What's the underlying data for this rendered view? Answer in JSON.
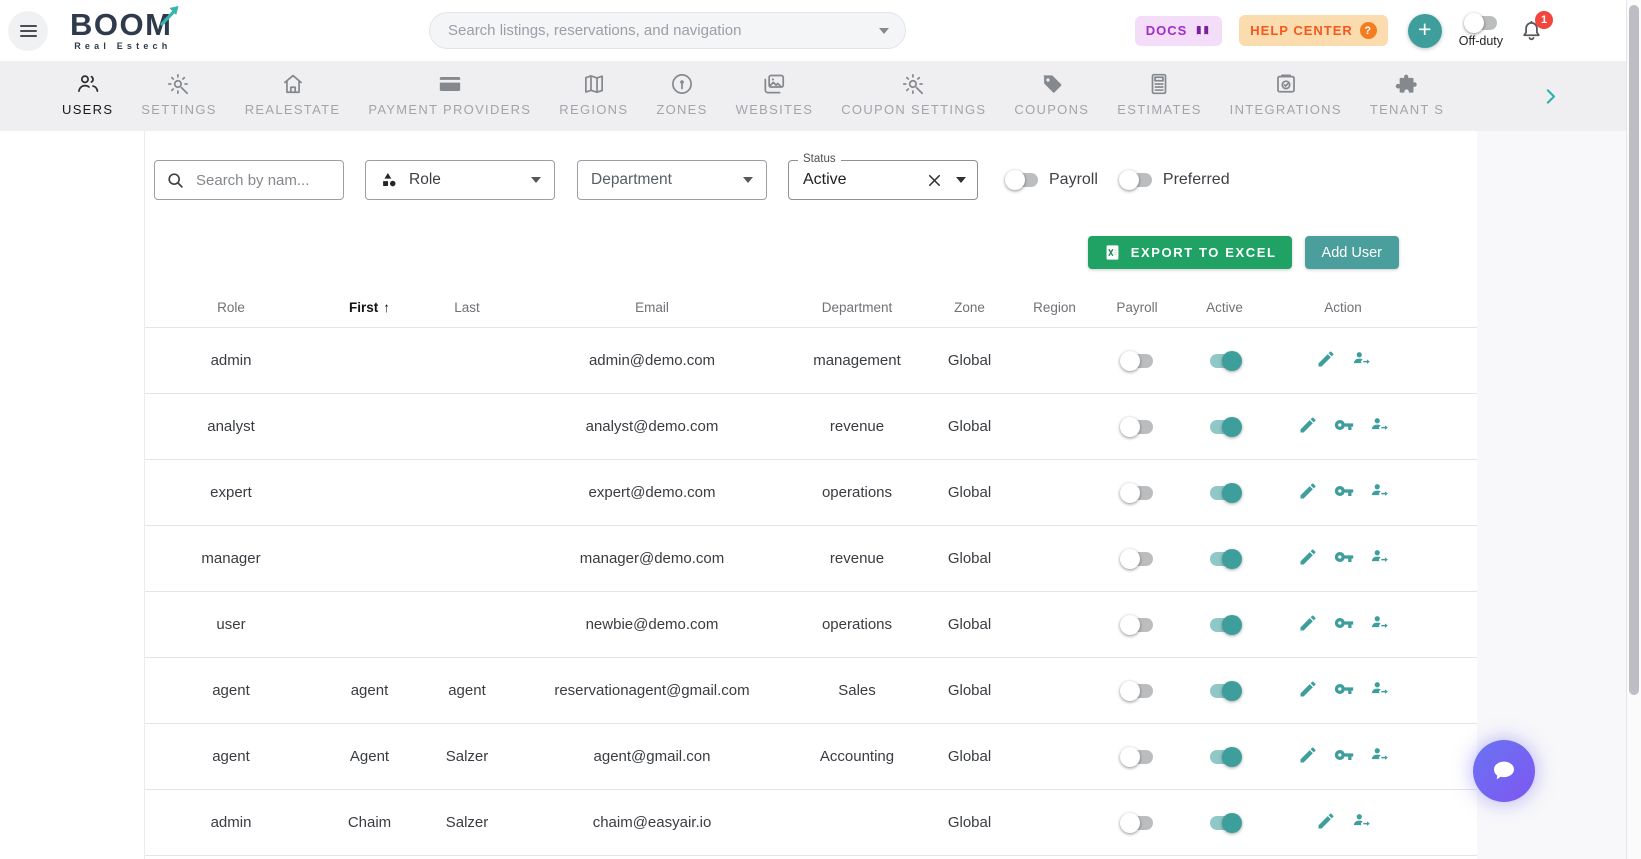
{
  "brand": {
    "name": "BOOM",
    "tagline": "Real Estech"
  },
  "topbar": {
    "search_placeholder": "Search listings, reservations, and navigation",
    "docs_label": "DOCS",
    "help_center_label": "HELP CENTER",
    "off_duty_label": "Off-duty",
    "notification_count": "1"
  },
  "tabs": [
    {
      "label": "USERS",
      "icon": "users-icon",
      "active": true
    },
    {
      "label": "SETTINGS",
      "icon": "settings-icon",
      "active": false
    },
    {
      "label": "REALESTATE",
      "icon": "home-icon",
      "active": false
    },
    {
      "label": "PAYMENT PROVIDERS",
      "icon": "credit-card-icon",
      "active": false
    },
    {
      "label": "REGIONS",
      "icon": "map-icon",
      "active": false
    },
    {
      "label": "ZONES",
      "icon": "location-pin-icon",
      "active": false
    },
    {
      "label": "WEBSITES",
      "icon": "gallery-icon",
      "active": false
    },
    {
      "label": "COUPON SETTINGS",
      "icon": "settings-icon",
      "active": false
    },
    {
      "label": "COUPONS",
      "icon": "tag-icon",
      "active": false
    },
    {
      "label": "ESTIMATES",
      "icon": "calculator-icon",
      "active": false
    },
    {
      "label": "INTEGRATIONS",
      "icon": "folder-check-icon",
      "active": false
    },
    {
      "label": "TENANT S",
      "icon": "puzzle-icon",
      "active": false
    }
  ],
  "filters": {
    "search_placeholder": "Search by nam...",
    "role_label": "Role",
    "department_label": "Department",
    "status_label": "Status",
    "status_value": "Active",
    "payroll_label": "Payroll",
    "preferred_label": "Preferred"
  },
  "buttons": {
    "export": "EXPORT TO EXCEL",
    "add_user": "Add User"
  },
  "table": {
    "columns": [
      "Role",
      "First",
      "Last",
      "Email",
      "Department",
      "Zone",
      "Region",
      "Payroll",
      "Active",
      "Action"
    ],
    "sorted_column": "First",
    "sort_direction": "asc",
    "rows": [
      {
        "role": "admin",
        "first": "",
        "last": "",
        "email": "admin@demo.com",
        "department": "management",
        "zone": "Global",
        "region": "",
        "payroll": false,
        "active": true,
        "actions": [
          "edit",
          "impersonate"
        ]
      },
      {
        "role": "analyst",
        "first": "",
        "last": "",
        "email": "analyst@demo.com",
        "department": "revenue",
        "zone": "Global",
        "region": "",
        "payroll": false,
        "active": true,
        "actions": [
          "edit",
          "key",
          "impersonate"
        ]
      },
      {
        "role": "expert",
        "first": "",
        "last": "",
        "email": "expert@demo.com",
        "department": "operations",
        "zone": "Global",
        "region": "",
        "payroll": false,
        "active": true,
        "actions": [
          "edit",
          "key",
          "impersonate"
        ]
      },
      {
        "role": "manager",
        "first": "",
        "last": "",
        "email": "manager@demo.com",
        "department": "revenue",
        "zone": "Global",
        "region": "",
        "payroll": false,
        "active": true,
        "actions": [
          "edit",
          "key",
          "impersonate"
        ]
      },
      {
        "role": "user",
        "first": "",
        "last": "",
        "email": "newbie@demo.com",
        "department": "operations",
        "zone": "Global",
        "region": "",
        "payroll": false,
        "active": true,
        "actions": [
          "edit",
          "key",
          "impersonate"
        ]
      },
      {
        "role": "agent",
        "first": "agent",
        "last": "agent",
        "email": "reservationagent@gmail.com",
        "department": "Sales",
        "zone": "Global",
        "region": "",
        "payroll": false,
        "active": true,
        "actions": [
          "edit",
          "key",
          "impersonate"
        ]
      },
      {
        "role": "agent",
        "first": "Agent",
        "last": "Salzer",
        "email": "agent@gmail.con",
        "department": "Accounting",
        "zone": "Global",
        "region": "",
        "payroll": false,
        "active": true,
        "actions": [
          "edit",
          "key",
          "impersonate"
        ]
      },
      {
        "role": "admin",
        "first": "Chaim",
        "last": "Salzer",
        "email": "chaim@easyair.io",
        "department": "",
        "zone": "Global",
        "region": "",
        "payroll": false,
        "active": true,
        "actions": [
          "edit",
          "impersonate"
        ]
      }
    ]
  },
  "colors": {
    "accent_teal": "#3d9e9c",
    "excel_green": "#1fa264",
    "docs_purple": "#a02cc9",
    "help_orange": "#f4581f",
    "badge_red": "#f1453d",
    "chat_purple": "#6f6bf3",
    "tabbar_gray": "#efeff1"
  }
}
